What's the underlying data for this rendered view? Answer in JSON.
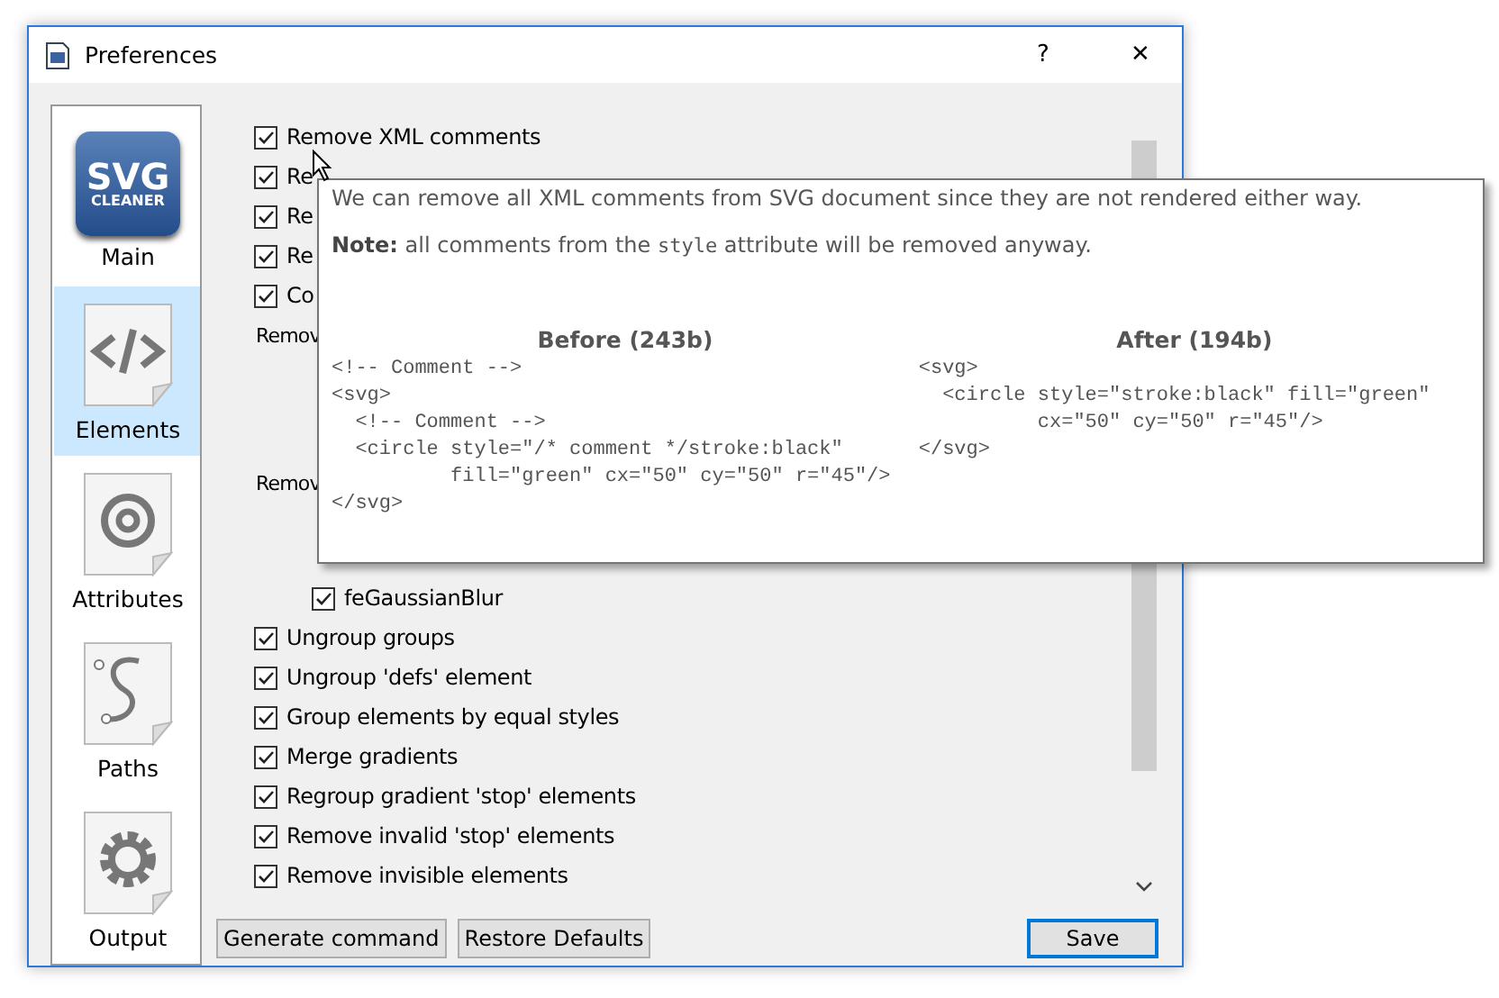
{
  "window": {
    "title": "Preferences",
    "help": "?",
    "close": "✕"
  },
  "sidebar": {
    "items": [
      {
        "label": "Main",
        "kind": "logo",
        "logo_text": [
          "SVG",
          "CLEANER"
        ],
        "selected": false
      },
      {
        "label": "Elements",
        "kind": "code",
        "selected": true
      },
      {
        "label": "Attributes",
        "kind": "at",
        "selected": false
      },
      {
        "label": "Paths",
        "kind": "path",
        "selected": false
      },
      {
        "label": "Output",
        "kind": "gear",
        "selected": false
      }
    ]
  },
  "options": [
    {
      "kind": "checkbox",
      "label": "Remove XML comments",
      "checked": true
    },
    {
      "kind": "checkbox",
      "label": "Re",
      "checked": true
    },
    {
      "kind": "checkbox",
      "label": "Re",
      "checked": true
    },
    {
      "kind": "checkbox",
      "label": "Re",
      "checked": true
    },
    {
      "kind": "checkbox",
      "label": "Co",
      "checked": true
    },
    {
      "kind": "group",
      "label": "Remov"
    },
    {
      "kind": "group",
      "label": "Remov",
      "children": [
        {
          "kind": "checkbox",
          "label": "feGaussianBlur",
          "checked": true
        }
      ]
    },
    {
      "kind": "checkbox",
      "label": "Ungroup groups",
      "checked": true
    },
    {
      "kind": "checkbox",
      "label": "Ungroup 'defs' element",
      "checked": true
    },
    {
      "kind": "checkbox",
      "label": "Group elements by equal styles",
      "checked": true
    },
    {
      "kind": "checkbox",
      "label": "Merge gradients",
      "checked": true
    },
    {
      "kind": "checkbox",
      "label": "Regroup gradient 'stop' elements",
      "checked": true
    },
    {
      "kind": "checkbox",
      "label": "Remove invalid 'stop' elements",
      "checked": true
    },
    {
      "kind": "checkbox",
      "label": "Remove invisible elements",
      "checked": true
    }
  ],
  "tooltip": {
    "text": "We can remove all XML comments from SVG document since they are not rendered either way.",
    "note": {
      "prefix": "**Note:** all comments from the",
      "code": "style",
      "suffix": "attribute will be removed anyway."
    },
    "before": {
      "title": "Before (243b)",
      "lines": [
        "<!-- Comment -->",
        "<svg>",
        "  <!-- Comment -->",
        "  <circle style=\"/* comment */stroke:black\"",
        "          fill=\"green\" cx=\"50\" cy=\"50\" r=\"45\"/>",
        "</svg>"
      ]
    },
    "after": {
      "title": "After (194b)",
      "lines": [
        "<svg>",
        "  <circle style=\"stroke:black\" fill=\"green\"",
        "          cx=\"50\" cy=\"50\" r=\"45\"/>",
        "</svg>"
      ]
    }
  },
  "buttons": [
    {
      "label": "Generate command",
      "kind": "left"
    },
    {
      "label": "Restore Defaults",
      "kind": "left"
    },
    {
      "label": "Save",
      "kind": "default"
    }
  ]
}
